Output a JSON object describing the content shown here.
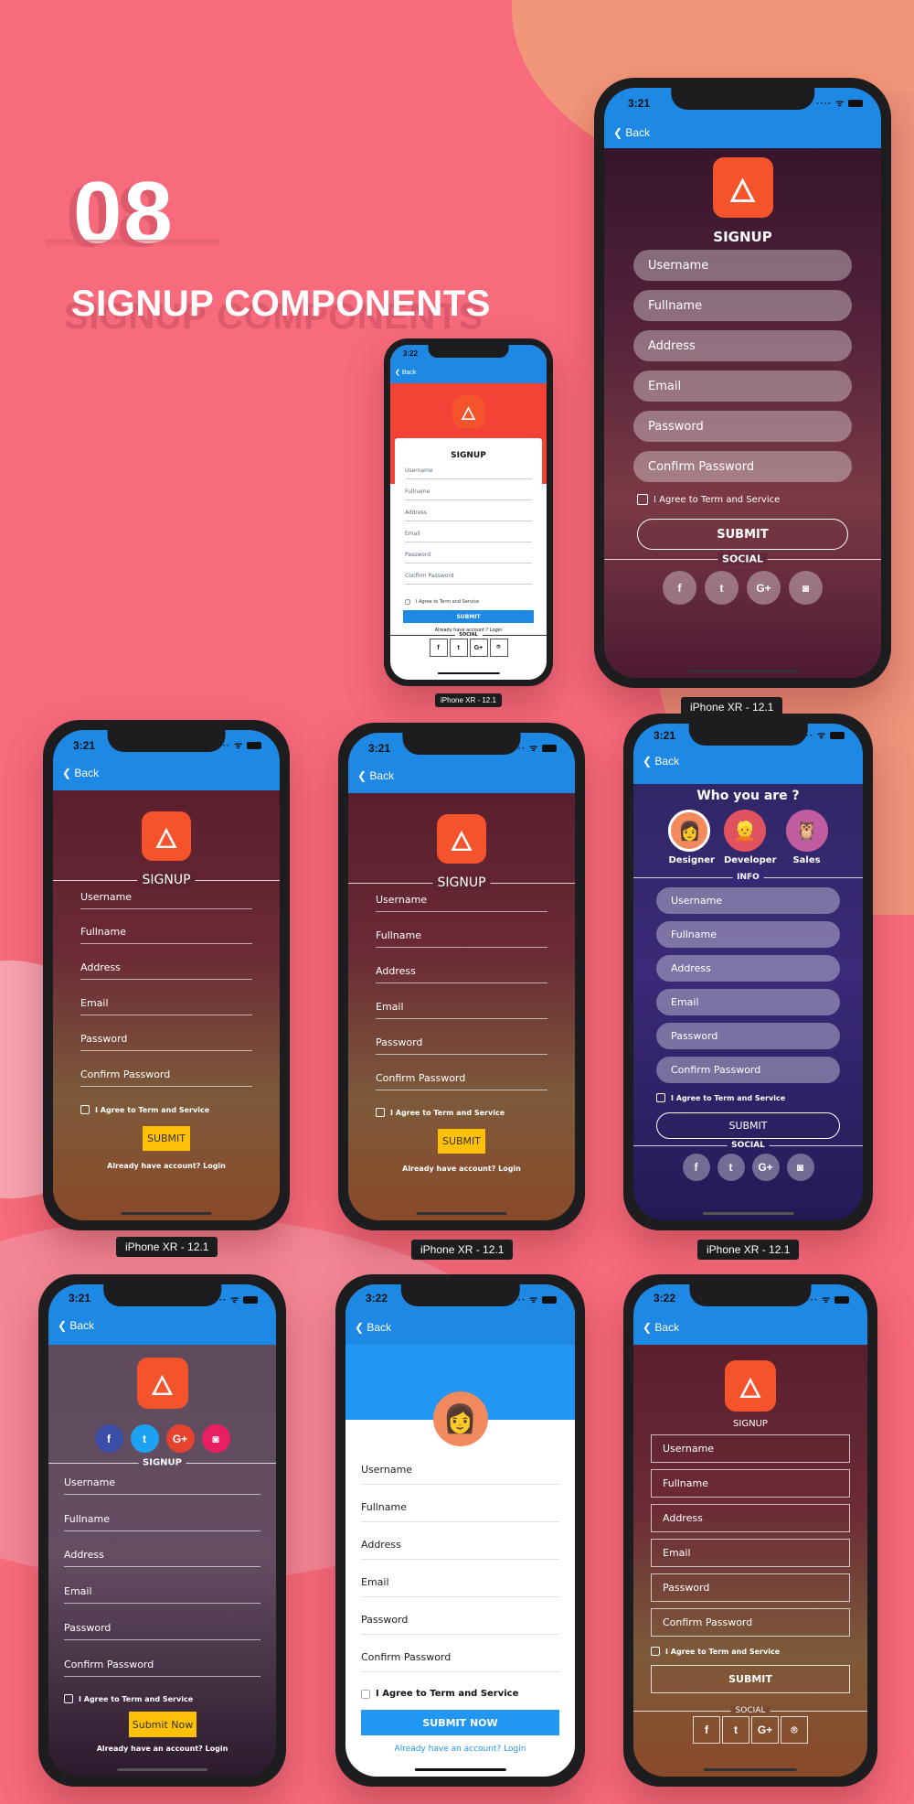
{
  "header": {
    "number": "08",
    "title": "SIGNUP COMPONENTS"
  },
  "device_label": "iPhone XR - 12.1",
  "common": {
    "back": "Back",
    "signup": "SIGNUP",
    "social": "SOCIAL",
    "info": "INFO",
    "agree": "I Agree to Term and Service",
    "fields": [
      "Username",
      "Fullname",
      "Address",
      "Email",
      "Password",
      "Confirm Password"
    ],
    "social_icons": [
      "facebook-icon",
      "twitter-icon",
      "google-plus-icon",
      "instagram-icon"
    ],
    "social_glyphs": [
      "f",
      "t",
      "G+",
      "◙"
    ]
  },
  "phones": {
    "big": {
      "time": "3:21",
      "submit": "SUBMIT"
    },
    "small": {
      "time": "3:22",
      "submit": "SUBMIT",
      "login": "Already have account ? Login",
      "social_glyphs": [
        "f",
        "t",
        "G+",
        "⌾"
      ]
    },
    "r2a": {
      "time": "3:21",
      "submit": "SUBMIT",
      "login": "Already have account? Login"
    },
    "r2b": {
      "time": "3:21",
      "submit": "SUBMIT",
      "login": "Already have account? Login"
    },
    "r2c": {
      "time": "3:21",
      "heading": "Who you are ?",
      "roles": [
        "Designer",
        "Developer",
        "Sales"
      ],
      "submit": "SUBMIT"
    },
    "r3a": {
      "time": "3:21",
      "submit": "Submit Now",
      "login": "Already have an account? Login"
    },
    "r3b": {
      "time": "3:22",
      "submit": "SUBMIT NOW",
      "login": "Already have an account? Login"
    },
    "r3c": {
      "time": "3:22",
      "submit": "SUBMIT",
      "social_glyphs": [
        "f",
        "t",
        "G+",
        "⌾"
      ]
    }
  },
  "colors": {
    "brand_blue": "#1e88e5",
    "logo_orange": "#f4532c",
    "submit_yellow": "#ffc107",
    "background": "#f76b7c"
  }
}
